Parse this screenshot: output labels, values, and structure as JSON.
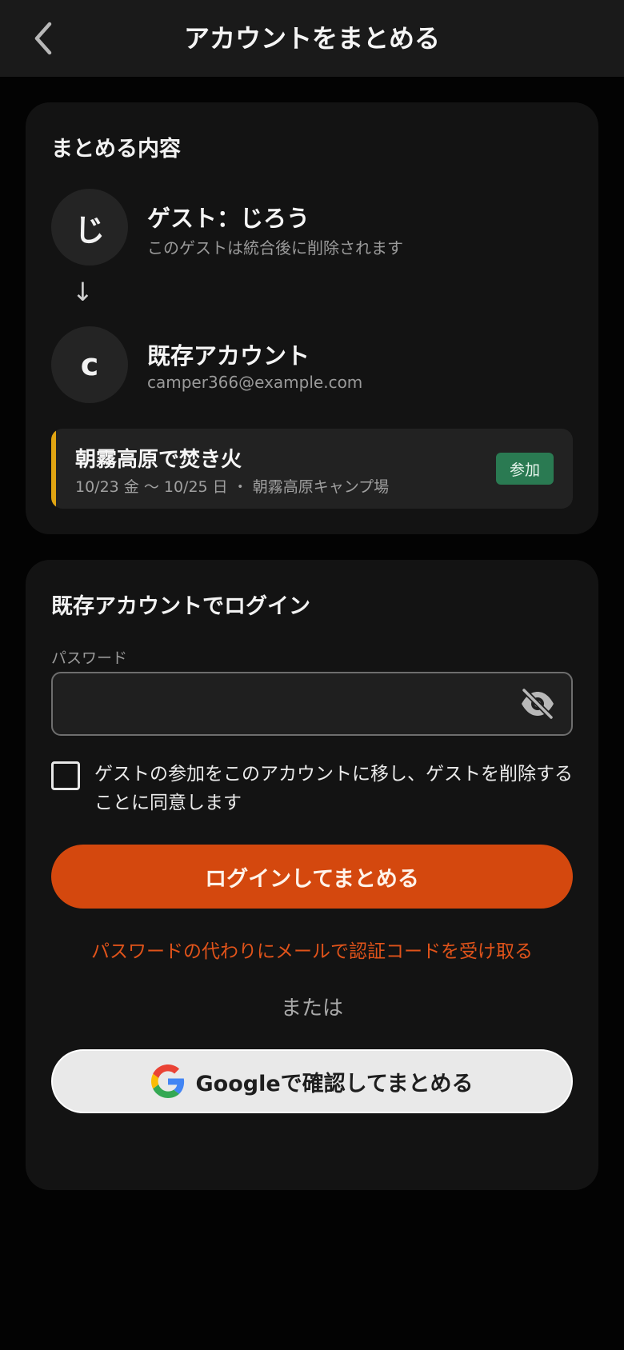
{
  "header": {
    "title": "アカウントをまとめる",
    "back_icon": "chevron-left-icon"
  },
  "merge": {
    "title": "まとめる内容",
    "guest": {
      "initial": "じ",
      "name": "ゲスト：じろう",
      "note": "このゲストは統合後に削除されます"
    },
    "arrow": "↓",
    "existing": {
      "initial": "c",
      "name": "既存アカウント",
      "email": "camper366@example.com"
    },
    "event": {
      "title": "朝霧高原で焚き火",
      "details": "10/23 金 〜 10/25 日 ・ 朝霧高原キャンプ場",
      "badge": "参加"
    }
  },
  "login": {
    "title": "既存アカウントでログイン",
    "password_label": "パスワード",
    "password_value": "",
    "password_placeholder": "",
    "consent_checked": false,
    "consent_text": "ゲストの参加をこのアカウントに移し、ゲストを削除することに同意します",
    "submit_label": "ログインしてまとめる",
    "email_code_link": "パスワードの代わりにメールで認証コードを受け取る",
    "or_label": "または",
    "google_label": "Googleで確認してまとめる"
  },
  "colors": {
    "accent": "#d4480e",
    "event_accent": "#e0a412",
    "badge": "#2a7a52",
    "background": "#030303",
    "card": "#131313"
  }
}
